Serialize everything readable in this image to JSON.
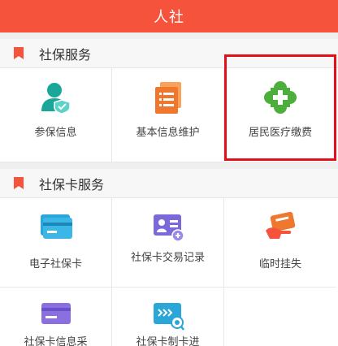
{
  "header": {
    "title": "人社"
  },
  "social_security": {
    "title": "社保服务",
    "items": [
      {
        "label": "参保信息",
        "icon": "person-shield-icon"
      },
      {
        "label": "基本信息维护",
        "icon": "document-list-icon"
      },
      {
        "label": "居民医疗缴费",
        "icon": "medical-cross-icon"
      }
    ]
  },
  "card_services": {
    "title": "社保卡服务",
    "items": [
      {
        "label": "电子社保卡",
        "icon": "card-icon"
      },
      {
        "label": "社保卡交易记录",
        "icon": "card-record-icon"
      },
      {
        "label": "临时挂失",
        "icon": "hand-card-icon"
      },
      {
        "label": "社保卡信息采",
        "icon": "card-info-icon"
      },
      {
        "label": "社保卡制卡进",
        "icon": "card-progress-icon"
      }
    ]
  },
  "colors": {
    "header": "#f5533b",
    "accent": "#f5533b",
    "highlight_border": "#e3101a"
  }
}
